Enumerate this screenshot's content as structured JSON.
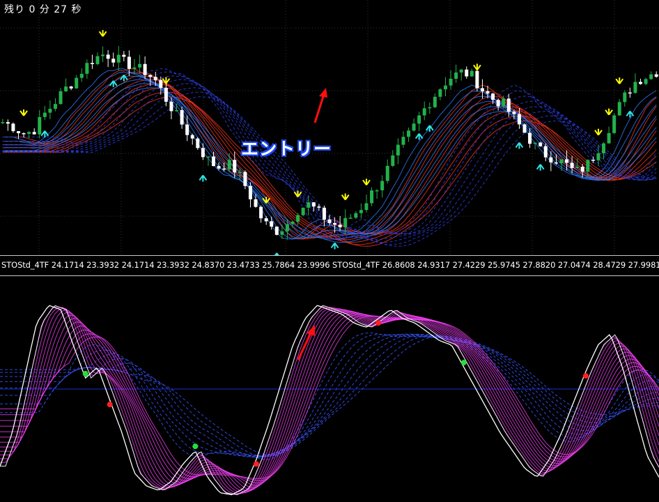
{
  "timer": {
    "text": "残り 0 分 27 秒"
  },
  "annotation": {
    "entry_text": "エントリー"
  },
  "indicator_bar": {
    "text": "STOStd_4TF 24.1714 23.3932 24.1714 23.3932 24.8370 23.4733 25.7864 23.9996 STOStd_4TF 26.8608 24.9317 27.4229 25.9745 27.8820 27.0474 28.4729 27.9981"
  },
  "colors": {
    "background": "#000000",
    "bull_candle": "#22b14c",
    "bear_candle": "#ffffff",
    "down_ribbon": "#e8321e",
    "up_ribbon": "#2f7cff",
    "slow_ribbon": "#2a3bd6",
    "osc_fast": "#ff44ff",
    "osc_slow": "#3a55ff",
    "osc_main": "#ffffff",
    "sell_arrow": "#ffff00",
    "buy_arrow": "#2ee6e6",
    "sell_dot": "#ff2020",
    "buy_dot": "#22e03a",
    "entry_arrow": "#ff1010",
    "grid": "#333333"
  },
  "chart_data": [
    {
      "type": "candlestick",
      "title": "",
      "price_path": [
        0.52,
        0.5,
        0.47,
        0.48,
        0.55,
        0.6,
        0.66,
        0.7,
        0.76,
        0.8,
        0.82,
        0.8,
        0.78,
        0.76,
        0.74,
        0.7,
        0.62,
        0.55,
        0.48,
        0.42,
        0.36,
        0.32,
        0.34,
        0.3,
        0.22,
        0.12,
        0.06,
        0.04,
        0.08,
        0.14,
        0.16,
        0.12,
        0.08,
        0.06,
        0.1,
        0.14,
        0.2,
        0.26,
        0.34,
        0.42,
        0.48,
        0.56,
        0.62,
        0.68,
        0.72,
        0.74,
        0.72,
        0.66,
        0.62,
        0.6,
        0.54,
        0.48,
        0.42,
        0.38,
        0.36,
        0.34,
        0.3,
        0.32,
        0.38,
        0.46,
        0.56,
        0.64,
        0.7,
        0.72,
        0.74
      ],
      "sell_signals": [
        2,
        10,
        16,
        26,
        29,
        34,
        36,
        47,
        59,
        60,
        61
      ],
      "buy_signals": [
        4,
        11,
        12,
        20,
        27,
        33,
        41,
        42,
        51,
        53,
        62
      ],
      "ribbons": [
        "down",
        "up",
        "slow"
      ]
    },
    {
      "type": "line",
      "title": "STOStd_4TF",
      "main_path": [
        0.15,
        0.3,
        0.55,
        0.8,
        0.88,
        0.86,
        0.7,
        0.55,
        0.6,
        0.45,
        0.3,
        0.12,
        0.06,
        0.04,
        0.08,
        0.16,
        0.22,
        0.1,
        0.03,
        0.02,
        0.05,
        0.18,
        0.34,
        0.52,
        0.7,
        0.82,
        0.88,
        0.86,
        0.84,
        0.8,
        0.78,
        0.82,
        0.86,
        0.82,
        0.8,
        0.76,
        0.72,
        0.7,
        0.6,
        0.5,
        0.4,
        0.3,
        0.22,
        0.14,
        0.1,
        0.18,
        0.3,
        0.44,
        0.58,
        0.7,
        0.75,
        0.6,
        0.4,
        0.2,
        0.1
      ],
      "sell_dots": [
        9,
        21,
        31,
        48
      ],
      "buy_dots": [
        7,
        16,
        38
      ],
      "zero_line": 0.5
    }
  ]
}
